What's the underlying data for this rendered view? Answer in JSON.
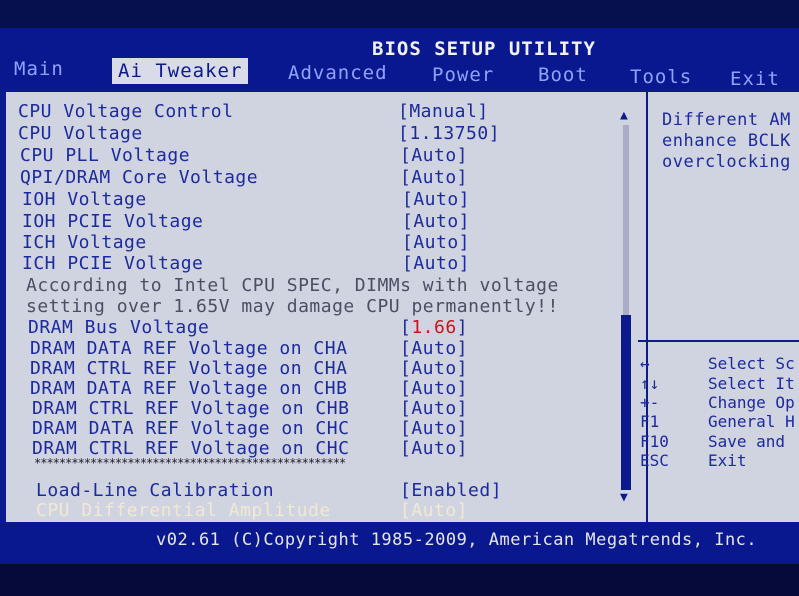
{
  "header": {
    "title": "BIOS SETUP UTILITY"
  },
  "tabs": [
    {
      "label": "Main"
    },
    {
      "label": "Ai Tweaker"
    },
    {
      "label": "Advanced"
    },
    {
      "label": "Power"
    },
    {
      "label": "Boot"
    },
    {
      "label": "Tools"
    },
    {
      "label": "Exit"
    }
  ],
  "settings": [
    {
      "label": "CPU Voltage Control",
      "value": "[Manual]"
    },
    {
      "label": "CPU Voltage",
      "value": "[1.13750]"
    },
    {
      "label": "CPU PLL Voltage",
      "value": "[Auto]"
    },
    {
      "label": "QPI/DRAM Core Voltage",
      "value": "[Auto]"
    },
    {
      "label": "IOH Voltage",
      "value": "[Auto]"
    },
    {
      "label": "IOH PCIE Voltage",
      "value": "[Auto]"
    },
    {
      "label": "ICH Voltage",
      "value": "[Auto]"
    },
    {
      "label": "ICH PCIE Voltage",
      "value": "[Auto]"
    }
  ],
  "warning": {
    "line1": "According to Intel CPU SPEC, DIMMs with voltage",
    "line2": "setting over 1.65V may damage CPU permanently!!"
  },
  "dram_settings": [
    {
      "label": "DRAM Bus Voltage",
      "value_open": "[",
      "value": "1.66",
      "value_close": "]"
    },
    {
      "label": "DRAM DATA REF Voltage on CHA",
      "value": "[Auto]"
    },
    {
      "label": "DRAM CTRL REF Voltage on CHA",
      "value": "[Auto]"
    },
    {
      "label": "DRAM DATA REF Voltage on CHB",
      "value": "[Auto]"
    },
    {
      "label": "DRAM CTRL REF Voltage on CHB",
      "value": "[Auto]"
    },
    {
      "label": "DRAM DATA REF Voltage on CHC",
      "value": "[Auto]"
    },
    {
      "label": "DRAM CTRL REF Voltage on CHC",
      "value": "[Auto]"
    }
  ],
  "separator": "**************************************************",
  "lower_settings": [
    {
      "label": "Load-Line Calibration",
      "value": "[Enabled]"
    },
    {
      "label": "CPU Differential Amplitude",
      "value": "[Auto]"
    }
  ],
  "help": {
    "lines": [
      "Different AM",
      "enhance BCLK",
      "overclocking"
    ],
    "keys": [
      {
        "key": "↔",
        "desc": "Select Sc"
      },
      {
        "key": "↑↓",
        "desc": "Select It"
      },
      {
        "key": "+-",
        "desc": "Change Op"
      },
      {
        "key": "F1",
        "desc": "General H"
      },
      {
        "key": "F10",
        "desc": "Save and"
      },
      {
        "key": "ESC",
        "desc": "Exit"
      }
    ]
  },
  "footer": {
    "copyright": "v02.61 (C)Copyright 1985-2009, American Megatrends, Inc."
  },
  "colors": {
    "background": "#0b1a8c",
    "panel": "#d0d3e0",
    "text": "#1c2aa0",
    "highlight": "#c8141c"
  }
}
